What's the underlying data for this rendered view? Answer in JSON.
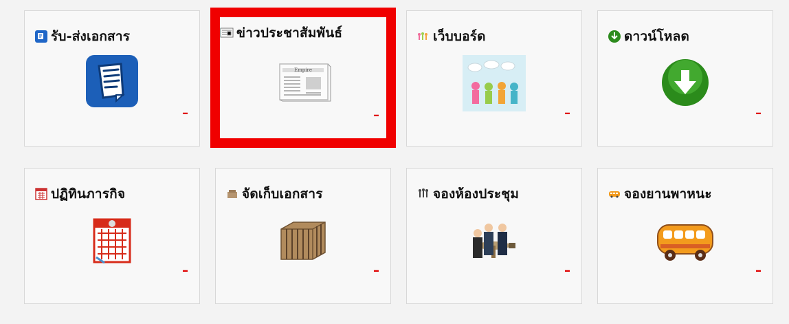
{
  "tiles": [
    {
      "title": "รับ-ส่งเอกสาร",
      "small_icon": "document-icon",
      "big_icon": "document-icon",
      "status": "–",
      "highlighted": false
    },
    {
      "title": "ข่าวประชาสัมพันธ์",
      "small_icon": "newspaper-icon",
      "big_icon": "newspaper-icon",
      "status": "–",
      "highlighted": true
    },
    {
      "title": "เว็บบอร์ด",
      "small_icon": "people-icon",
      "big_icon": "people-speech-icon",
      "status": "–",
      "highlighted": false
    },
    {
      "title": "ดาวน์โหลด",
      "small_icon": "download-icon",
      "big_icon": "download-icon",
      "status": "–",
      "highlighted": false
    },
    {
      "title": "ปฏิทินภารกิจ",
      "small_icon": "calendar-icon",
      "big_icon": "calendar-icon",
      "status": "–",
      "highlighted": false
    },
    {
      "title": "จัดเก็บเอกสาร",
      "small_icon": "box-icon",
      "big_icon": "box-icon",
      "status": "–",
      "highlighted": false
    },
    {
      "title": "จองห้องประชุม",
      "small_icon": "meeting-icon",
      "big_icon": "meeting-icon",
      "status": "–",
      "highlighted": false
    },
    {
      "title": "จองยานพาหนะ",
      "small_icon": "bus-icon",
      "big_icon": "bus-icon",
      "status": "–",
      "highlighted": false
    }
  ],
  "colors": {
    "highlight": "#f00000",
    "status_dash": "#e00000",
    "tile_bg": "#f8f8f8",
    "page_bg": "#f3f3f3"
  }
}
